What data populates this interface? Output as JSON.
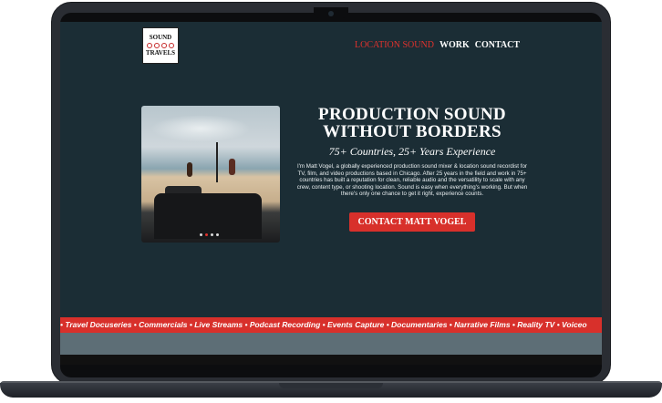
{
  "logo": {
    "top": "SOUND",
    "bottom": "TRAVELS"
  },
  "nav": {
    "items": [
      {
        "label": "LOCATION SOUND",
        "active": true
      },
      {
        "label": "WORK",
        "active": false
      },
      {
        "label": "CONTACT",
        "active": false
      }
    ]
  },
  "hero": {
    "title_line1": "PRODUCTION SOUND",
    "title_line2": "WITHOUT BORDERS",
    "subtitle": "75+ Countries, 25+ Years Experience",
    "body": "I'm Matt Vogel, a globally experienced production sound mixer & location sound recordist for TV, film, and video productions based in Chicago. After 25 years in the field and work in 75+ countries has built a reputation for clean, reliable audio and the versatility to scale with any crew, content type, or shooting location. Sound is easy when everything's working. But when there's only one chance to get it right, experience counts.",
    "cta": "CONTACT MATT VOGEL"
  },
  "carousel": {
    "active_index": 1,
    "count": 4
  },
  "ticker": {
    "text": "• Travel Docuseries • Commercials • Live Streams • Podcast Recording • Events Capture • Documentaries • Narrative Films • Reality TV • Voiceo"
  },
  "colors": {
    "accent": "#d8302b",
    "background": "#1b2d35"
  }
}
